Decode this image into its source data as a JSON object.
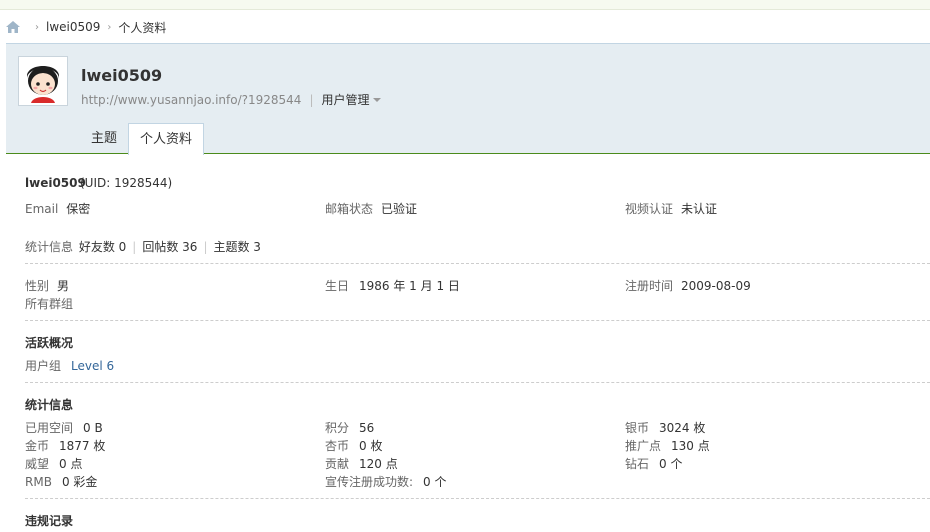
{
  "breadcrumb": {
    "user": "lwei0509",
    "current": "个人资料"
  },
  "profile": {
    "username": "lwei0509",
    "url": "http://www.yusannjao.info/?1928544",
    "manage": "用户管理",
    "tabs": [
      "主题",
      "个人资料"
    ],
    "active_tab": "个人资料"
  },
  "info": {
    "title_name": "lwei0509",
    "title_uid": "(UID: 1928544)",
    "email_label": "Email",
    "email_value": "保密",
    "mailstatus_label": "邮箱状态",
    "mailstatus_value": "已验证",
    "video_label": "视频认证",
    "video_value": "未认证",
    "stats_label": "统计信息",
    "friends": "好友数 0",
    "replies": "回帖数 36",
    "topics": "主题数 3",
    "gender_label": "性别",
    "gender_value": "男",
    "birthday_label": "生日",
    "birthday_value": "1986 年 1 月 1 日",
    "regtime_label": "注册时间",
    "regtime_value": "2009-08-09",
    "groups_label": "所有群组"
  },
  "activity": {
    "heading": "活跃概况",
    "usergroup_label": "用户组",
    "usergroup_value": "Level 6"
  },
  "statistics": {
    "heading": "统计信息",
    "space_label": "已用空间",
    "space_value": "0 B",
    "points_label": "积分",
    "points_value": "56",
    "silver_label": "银币",
    "silver_value": "3024 枚",
    "gold_label": "金币",
    "gold_value": "1877 枚",
    "apricot_label": "杏币",
    "apricot_value": "0 枚",
    "promo_label": "推广点",
    "promo_value": "130 点",
    "prestige_label": "威望",
    "prestige_value": "0 点",
    "contrib_label": "贡献",
    "contrib_value": "120 点",
    "diamond_label": "钻石",
    "diamond_value": "0 个",
    "rmb_label": "RMB",
    "rmb_value": "0 彩金",
    "invite_label": "宣传注册成功数:",
    "invite_value": "0 个"
  },
  "violations": {
    "heading": "违规记录"
  }
}
